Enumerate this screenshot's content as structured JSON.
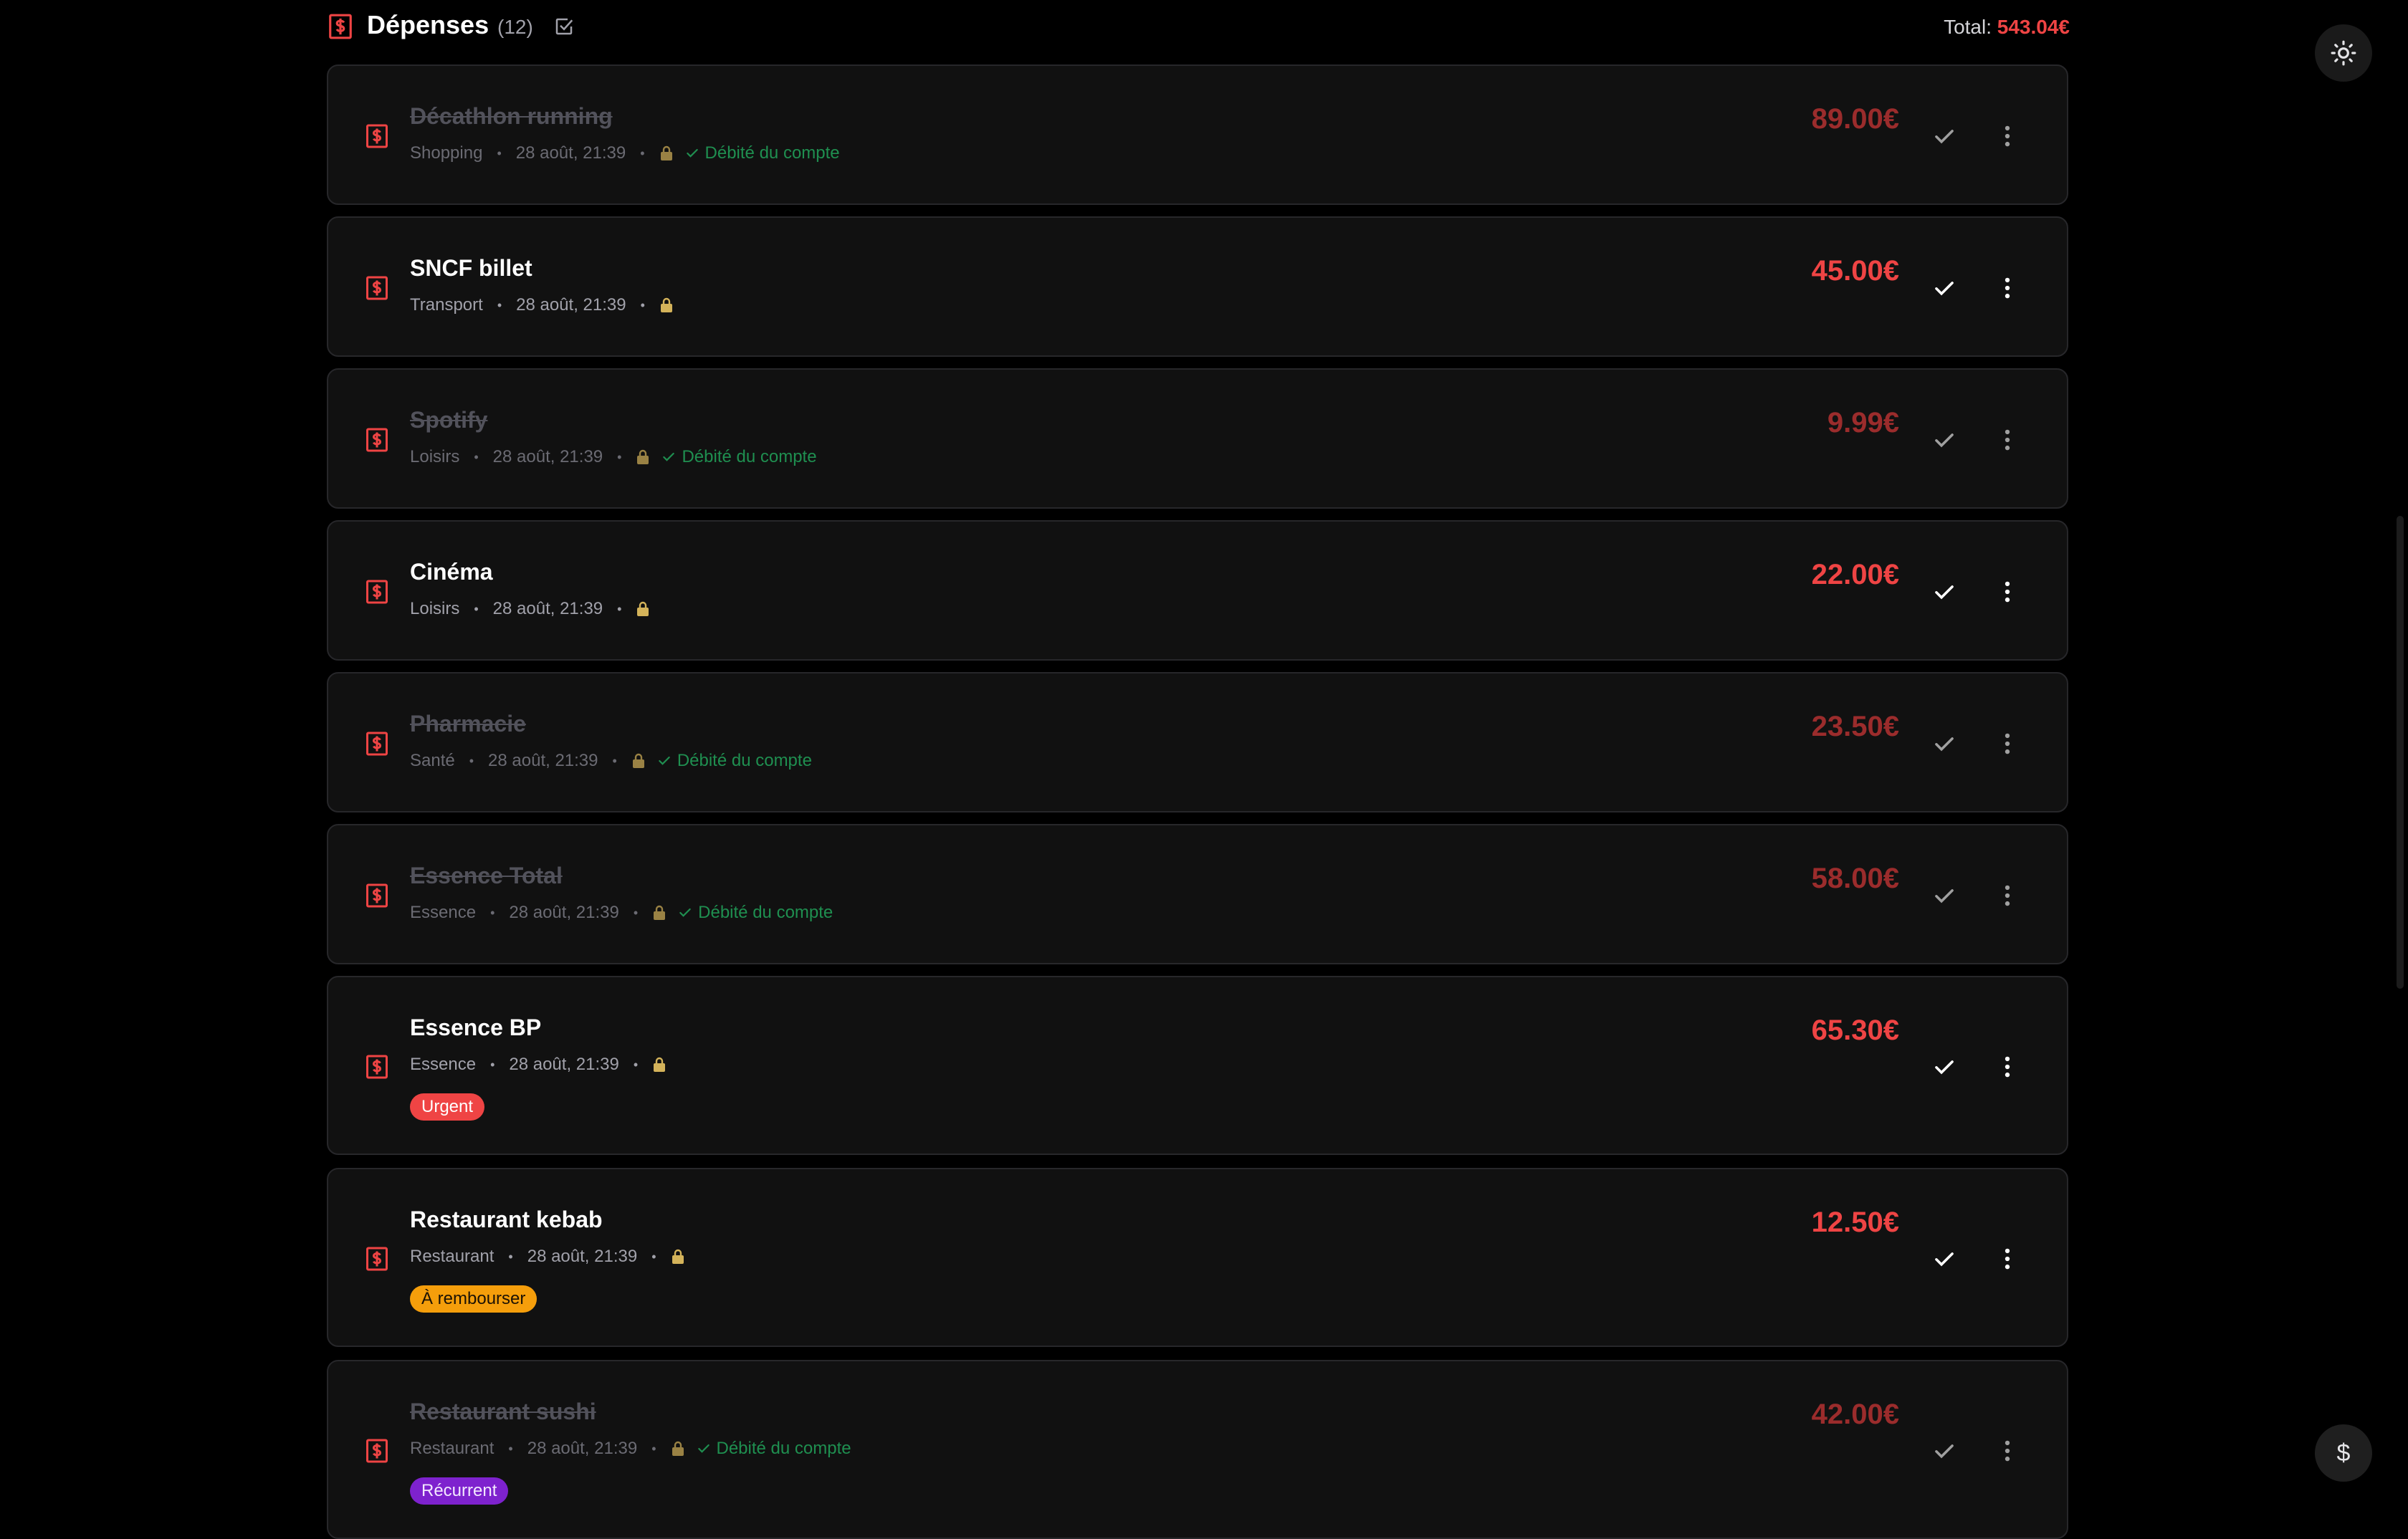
{
  "header": {
    "title": "Dépenses",
    "count": "(12)",
    "total_label": "Total:",
    "total_value": "543.04€",
    "icons": {
      "app": "dollar-document-icon",
      "select": "checkbox-icon"
    }
  },
  "expenses": [
    {
      "name": "Décathlon running",
      "category": "Shopping",
      "date": "28 août, 21:39",
      "amount": "89.00€",
      "debited": true,
      "debited_label": "Débité du compte",
      "tag": ""
    },
    {
      "name": "SNCF billet",
      "category": "Transport",
      "date": "28 août, 21:39",
      "amount": "45.00€",
      "debited": false,
      "tag": ""
    },
    {
      "name": "Spotify",
      "category": "Loisirs",
      "date": "28 août, 21:39",
      "amount": "9.99€",
      "debited": true,
      "debited_label": "Débité du compte",
      "tag": ""
    },
    {
      "name": "Cinéma",
      "category": "Loisirs",
      "date": "28 août, 21:39",
      "amount": "22.00€",
      "debited": false,
      "tag": ""
    },
    {
      "name": "Pharmacie",
      "category": "Santé",
      "date": "28 août, 21:39",
      "amount": "23.50€",
      "debited": true,
      "debited_label": "Débité du compte",
      "tag": ""
    },
    {
      "name": "Essence Total",
      "category": "Essence",
      "date": "28 août, 21:39",
      "amount": "58.00€",
      "debited": true,
      "debited_label": "Débité du compte",
      "tag": ""
    },
    {
      "name": "Essence BP",
      "category": "Essence",
      "date": "28 août, 21:39",
      "amount": "65.30€",
      "debited": false,
      "tag": "Urgent"
    },
    {
      "name": "Restaurant kebab",
      "category": "Restaurant",
      "date": "28 août, 21:39",
      "amount": "12.50€",
      "debited": false,
      "tag": "À rembourser"
    },
    {
      "name": "Restaurant sushi",
      "category": "Restaurant",
      "date": "28 août, 21:39",
      "amount": "42.00€",
      "debited": true,
      "debited_label": "Débité du compte",
      "tag": "Récurrent"
    }
  ],
  "floating": {
    "theme_icon": "sun-icon",
    "add_icon": "dollar-icon",
    "add_label": "$"
  },
  "colors": {
    "accent": "#ef4444",
    "debited": "#22a85c",
    "urgent": "#ef4444",
    "rembourser": "#f59e0b",
    "recurrent": "#7e22ce",
    "background": "#000000",
    "card": "#111111"
  }
}
